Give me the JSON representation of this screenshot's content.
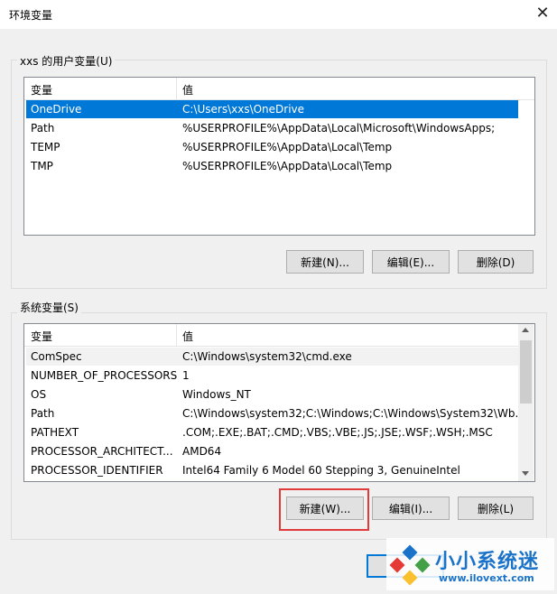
{
  "window": {
    "title": "环境变量",
    "close_glyph": "✕"
  },
  "user_vars": {
    "group_label": "xxs 的用户变量(U)",
    "columns": [
      "变量",
      "值"
    ],
    "rows": [
      {
        "name": "OneDrive",
        "value": "C:\\Users\\xxs\\OneDrive",
        "selected": true
      },
      {
        "name": "Path",
        "value": "%USERPROFILE%\\AppData\\Local\\Microsoft\\WindowsApps;"
      },
      {
        "name": "TEMP",
        "value": "%USERPROFILE%\\AppData\\Local\\Temp"
      },
      {
        "name": "TMP",
        "value": "%USERPROFILE%\\AppData\\Local\\Temp"
      }
    ],
    "buttons": {
      "new": "新建(N)...",
      "edit": "编辑(E)...",
      "delete": "删除(D)"
    }
  },
  "system_vars": {
    "group_label": "系统变量(S)",
    "columns": [
      "变量",
      "值"
    ],
    "rows": [
      {
        "name": "ComSpec",
        "value": "C:\\Windows\\system32\\cmd.exe"
      },
      {
        "name": "NUMBER_OF_PROCESSORS",
        "value": "1"
      },
      {
        "name": "OS",
        "value": "Windows_NT"
      },
      {
        "name": "Path",
        "value": "C:\\Windows\\system32;C:\\Windows;C:\\Windows\\System32\\Wb..."
      },
      {
        "name": "PATHEXT",
        "value": ".COM;.EXE;.BAT;.CMD;.VBS;.VBE;.JS;.JSE;.WSF;.WSH;.MSC"
      },
      {
        "name": "PROCESSOR_ARCHITECT...",
        "value": "AMD64"
      },
      {
        "name": "PROCESSOR_IDENTIFIER",
        "value": "Intel64 Family 6 Model 60 Stepping 3, GenuineIntel"
      }
    ],
    "buttons": {
      "new": "新建(W)...",
      "edit": "编辑(I)...",
      "delete": "删除(L)"
    }
  },
  "watermark": {
    "brand": "小小系统迷",
    "url": "www.ilovext.com"
  },
  "colors": {
    "selection": "#0078d7",
    "highlight_box": "#e03a3a",
    "brand_blue": "#1a73c8"
  }
}
